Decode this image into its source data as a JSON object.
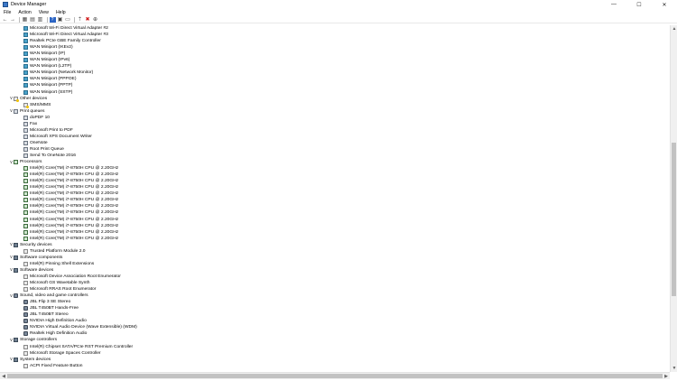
{
  "window": {
    "title": "Device Manager",
    "controls": {
      "minimize": "—",
      "maximize": "☐",
      "close": "✕"
    }
  },
  "menu": [
    "File",
    "Action",
    "View",
    "Help"
  ],
  "toolbar": [
    {
      "name": "back-icon",
      "glyph": "←"
    },
    {
      "name": "forward-icon",
      "glyph": "→"
    },
    {
      "sep": true
    },
    {
      "name": "properties-icon",
      "glyph": "▦"
    },
    {
      "name": "show-hide-tree-icon",
      "glyph": "▤"
    },
    {
      "name": "view-resources-icon",
      "glyph": "▥"
    },
    {
      "sep": true
    },
    {
      "name": "help-icon",
      "glyph": "?"
    },
    {
      "name": "computer-icon",
      "glyph": "▣"
    },
    {
      "name": "monitor-icon",
      "glyph": "▭"
    },
    {
      "sep": true
    },
    {
      "name": "update-driver-icon",
      "glyph": "⇡"
    },
    {
      "name": "uninstall-icon",
      "glyph": "✖"
    },
    {
      "name": "scan-hardware-icon",
      "glyph": "⊕"
    }
  ],
  "tree": [
    {
      "level": 1,
      "icon": "net",
      "label": "Microsoft Wi-Fi Direct Virtual Adapter #2"
    },
    {
      "level": 1,
      "icon": "net",
      "label": "Microsoft Wi-Fi Direct Virtual Adapter #3"
    },
    {
      "level": 1,
      "icon": "net",
      "label": "Realtek PCIe GBE Family Controller"
    },
    {
      "level": 1,
      "icon": "net",
      "label": "WAN Miniport (IKEv2)"
    },
    {
      "level": 1,
      "icon": "net",
      "label": "WAN Miniport (IP)"
    },
    {
      "level": 1,
      "icon": "net",
      "label": "WAN Miniport (IPv6)"
    },
    {
      "level": 1,
      "icon": "net",
      "label": "WAN Miniport (L2TP)"
    },
    {
      "level": 1,
      "icon": "net",
      "label": "WAN Miniport (Network Monitor)"
    },
    {
      "level": 1,
      "icon": "net",
      "label": "WAN Miniport (PPPOE)"
    },
    {
      "level": 1,
      "icon": "net",
      "label": "WAN Miniport (PPTP)"
    },
    {
      "level": 1,
      "icon": "net",
      "label": "WAN Miniport (SSTP)"
    },
    {
      "level": 0,
      "icon": "warn",
      "label": "Other devices",
      "expander": "v"
    },
    {
      "level": 1,
      "icon": "warn",
      "label": "SMS/MMS"
    },
    {
      "level": 0,
      "icon": "prn",
      "label": "Print queues",
      "expander": "v"
    },
    {
      "level": 1,
      "icon": "prn",
      "label": "doPDF 10"
    },
    {
      "level": 1,
      "icon": "prn",
      "label": "Fax"
    },
    {
      "level": 1,
      "icon": "prn",
      "label": "Microsoft Print to PDF"
    },
    {
      "level": 1,
      "icon": "prn",
      "label": "Microsoft XPS Document Writer"
    },
    {
      "level": 1,
      "icon": "prn",
      "label": "OneNote"
    },
    {
      "level": 1,
      "icon": "prn",
      "label": "Root Print Queue"
    },
    {
      "level": 1,
      "icon": "prn",
      "label": "Send To OneNote 2016"
    },
    {
      "level": 0,
      "icon": "cpu",
      "label": "Processors",
      "expander": "v"
    },
    {
      "level": 1,
      "icon": "cpu",
      "label": "Intel(R) Core(TM) i7-8750H CPU @ 2.20GHz"
    },
    {
      "level": 1,
      "icon": "cpu",
      "label": "Intel(R) Core(TM) i7-8750H CPU @ 2.20GHz"
    },
    {
      "level": 1,
      "icon": "cpu",
      "label": "Intel(R) Core(TM) i7-8750H CPU @ 2.20GHz"
    },
    {
      "level": 1,
      "icon": "cpu",
      "label": "Intel(R) Core(TM) i7-8750H CPU @ 2.20GHz"
    },
    {
      "level": 1,
      "icon": "cpu",
      "label": "Intel(R) Core(TM) i7-8750H CPU @ 2.20GHz"
    },
    {
      "level": 1,
      "icon": "cpu",
      "label": "Intel(R) Core(TM) i7-8750H CPU @ 2.20GHz"
    },
    {
      "level": 1,
      "icon": "cpu",
      "label": "Intel(R) Core(TM) i7-8750H CPU @ 2.20GHz"
    },
    {
      "level": 1,
      "icon": "cpu",
      "label": "Intel(R) Core(TM) i7-8750H CPU @ 2.20GHz"
    },
    {
      "level": 1,
      "icon": "cpu",
      "label": "Intel(R) Core(TM) i7-8750H CPU @ 2.20GHz"
    },
    {
      "level": 1,
      "icon": "cpu",
      "label": "Intel(R) Core(TM) i7-8750H CPU @ 2.20GHz"
    },
    {
      "level": 1,
      "icon": "cpu",
      "label": "Intel(R) Core(TM) i7-8750H CPU @ 2.20GHz"
    },
    {
      "level": 1,
      "icon": "cpu",
      "label": "Intel(R) Core(TM) i7-8750H CPU @ 2.20GHz"
    },
    {
      "level": 0,
      "icon": "cat",
      "label": "Security devices",
      "expander": "v"
    },
    {
      "level": 1,
      "icon": "dev",
      "label": "Trusted Platform Module 2.0"
    },
    {
      "level": 0,
      "icon": "cat",
      "label": "Software components",
      "expander": "v"
    },
    {
      "level": 1,
      "icon": "dev",
      "label": "Intel(R) Pinning Shell Extensions"
    },
    {
      "level": 0,
      "icon": "cat",
      "label": "Software devices",
      "expander": "v"
    },
    {
      "level": 1,
      "icon": "dev",
      "label": "Microsoft Device Association Root Enumerator"
    },
    {
      "level": 1,
      "icon": "dev",
      "label": "Microsoft GS Wavetable Synth"
    },
    {
      "level": 1,
      "icon": "dev",
      "label": "Microsoft RRAS Root Enumerator"
    },
    {
      "level": 0,
      "icon": "snd",
      "label": "Sound, video and game controllers",
      "expander": "v"
    },
    {
      "level": 1,
      "icon": "snd",
      "label": "JBL Flip 3 SE Stereo"
    },
    {
      "level": 1,
      "icon": "snd",
      "label": "JBL T450BT Hands-Free"
    },
    {
      "level": 1,
      "icon": "snd",
      "label": "JBL T450BT Stereo"
    },
    {
      "level": 1,
      "icon": "snd",
      "label": "NVIDIA High Definition Audio"
    },
    {
      "level": 1,
      "icon": "snd",
      "label": "NVIDIA Virtual Audio Device (Wave Extensible) (WDM)"
    },
    {
      "level": 1,
      "icon": "snd",
      "label": "Realtek High Definition Audio"
    },
    {
      "level": 0,
      "icon": "cat",
      "label": "Storage controllers",
      "expander": "v"
    },
    {
      "level": 1,
      "icon": "dev",
      "label": "Intel(R) Chipset SATA/PCIe RST Premium Controller"
    },
    {
      "level": 1,
      "icon": "dev",
      "label": "Microsoft Storage Spaces Controller"
    },
    {
      "level": 0,
      "icon": "cat",
      "label": "System devices",
      "expander": "v"
    },
    {
      "level": 1,
      "icon": "dev",
      "label": "ACPI Fixed Feature Button"
    }
  ],
  "scrollbars": {
    "up": "▲",
    "down": "▼",
    "left": "◀",
    "right": "▶"
  }
}
